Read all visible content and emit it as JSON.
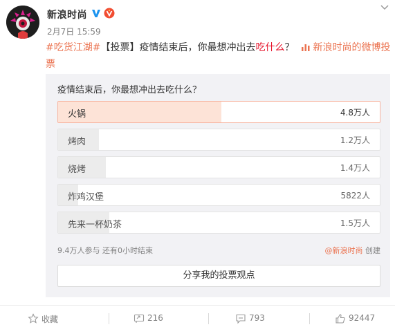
{
  "post": {
    "author": "新浪时尚",
    "time": "2月7日 15:59",
    "topic": "#吃货江湖#",
    "text_before": "【投票】疫情结束后，你最想冲出去",
    "text_highlight": "吃什么",
    "text_after": "？",
    "source_link": "新浪时尚的微博投票"
  },
  "vote": {
    "question": "疫情结束后，你最想冲出去吃什么？",
    "options": [
      {
        "label": "火锅",
        "count": "4.8万人",
        "share": 0.507,
        "selected": true
      },
      {
        "label": "烤肉",
        "count": "1.2万人",
        "share": 0.127,
        "selected": false
      },
      {
        "label": "烧烤",
        "count": "1.4万人",
        "share": 0.148,
        "selected": false
      },
      {
        "label": "炸鸡汉堡",
        "count": "5822人",
        "share": 0.062,
        "selected": false
      },
      {
        "label": "先来一杯奶茶",
        "count": "1.5万人",
        "share": 0.159,
        "selected": false
      }
    ],
    "meta": "9.4万人参与 还有0小时结束",
    "creator": "@新浪时尚",
    "creator_suffix": " 创建",
    "share_button": "分享我的投票观点"
  },
  "actions": {
    "favorite": "收藏",
    "repost": "216",
    "comment": "793",
    "like": "92447"
  },
  "colors": {
    "accent": "#eb7350",
    "highlight": "#e6162d",
    "verified": "#1b93ef",
    "vip": "#f14d32"
  }
}
